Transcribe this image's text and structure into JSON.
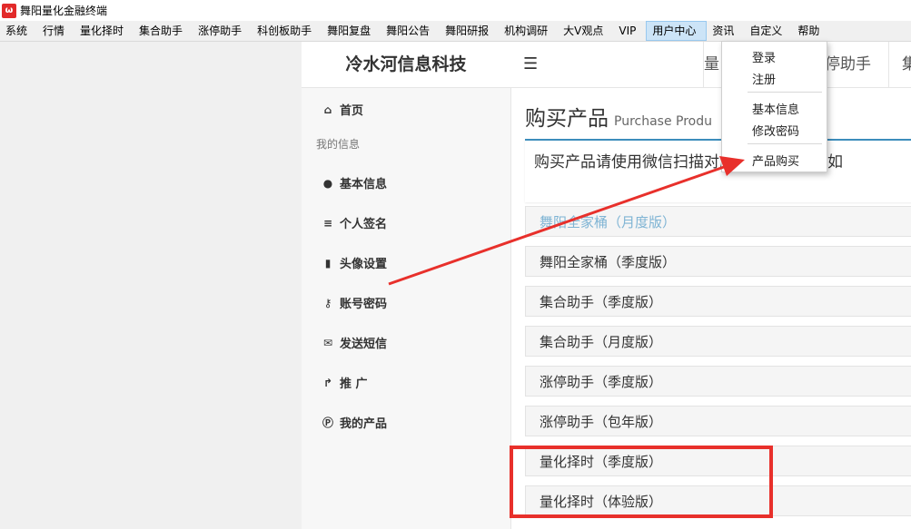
{
  "window": {
    "title": "舞阳量化金融终端"
  },
  "menubar": {
    "items": [
      "系统",
      "行情",
      "量化择时",
      "集合助手",
      "涨停助手",
      "科创板助手",
      "舞阳复盘",
      "舞阳公告",
      "舞阳研报",
      "机构调研",
      "大V观点",
      "VIP",
      "用户中心",
      "资讯",
      "自定义",
      "帮助"
    ]
  },
  "user_menu": {
    "items": [
      "登录",
      "注册",
      "基本信息",
      "修改密码",
      "产品购买"
    ]
  },
  "header": {
    "brand": "冷水河信息科技",
    "tab1": "量",
    "tab2": "停助手",
    "tab3": "集"
  },
  "sidebar": {
    "home": "首页",
    "group_label": "我的信息",
    "items": [
      "基本信息",
      "个人签名",
      "头像设置",
      "账号密码",
      "发送短信",
      "推 广",
      "我的产品"
    ]
  },
  "content": {
    "title": "购买产品",
    "subtitle": "Purchase Produ",
    "notice": "购买产品请使用微信扫描对应二维码支付，如",
    "products": [
      "舞阳全家桶（月度版）",
      "舞阳全家桶（季度版）",
      "集合助手（季度版）",
      "集合助手（月度版）",
      "涨停助手（季度版）",
      "涨停助手（包年版）",
      "量化择时（季度版）",
      "量化择时（体验版）"
    ]
  },
  "colors": {
    "accent": "#3c8dbc",
    "annotation": "#e8302b",
    "link_highlight": "#7fb4d4"
  }
}
